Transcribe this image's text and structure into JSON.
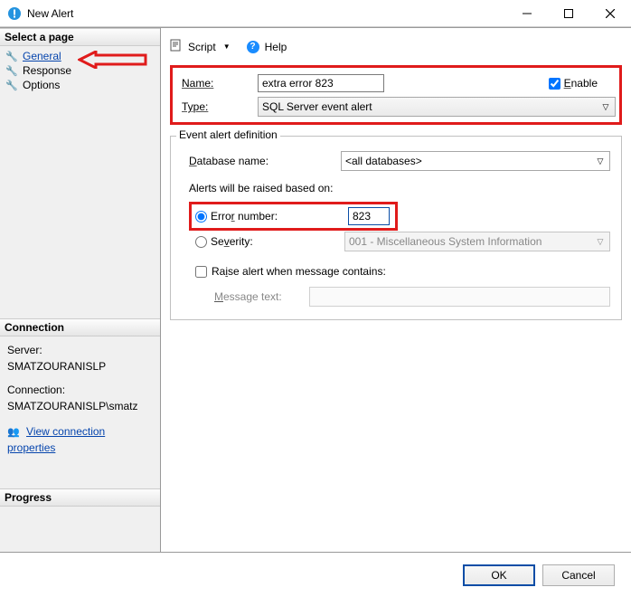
{
  "window": {
    "title": "New Alert"
  },
  "left": {
    "select_header": "Select a page",
    "pages": {
      "general": "General",
      "response": "Response",
      "options": "Options"
    },
    "connection_header": "Connection",
    "server_label": "Server:",
    "server_value": "SMATZOURANISLP",
    "conn_label": "Connection:",
    "conn_value": "SMATZOURANISLP\\smatz",
    "view_props": "View connection properties",
    "progress_header": "Progress"
  },
  "toolbar": {
    "script": "Script",
    "help": "Help"
  },
  "form": {
    "name_label": "Name:",
    "name_value": "extra error 823",
    "enable_label": "Enable",
    "type_label": "Type:",
    "type_value": "SQL Server event alert"
  },
  "group": {
    "title": "Event alert definition",
    "db_label": "Database name:",
    "db_value": "<all databases>",
    "based_on": "Alerts will be raised based on:",
    "error_label": "Error number:",
    "error_value": "823",
    "severity_label": "Severity:",
    "severity_value": "001 - Miscellaneous System Information",
    "raise_label": "Raise alert when message contains:",
    "msg_label": "Message text:"
  },
  "footer": {
    "ok": "OK",
    "cancel": "Cancel"
  }
}
